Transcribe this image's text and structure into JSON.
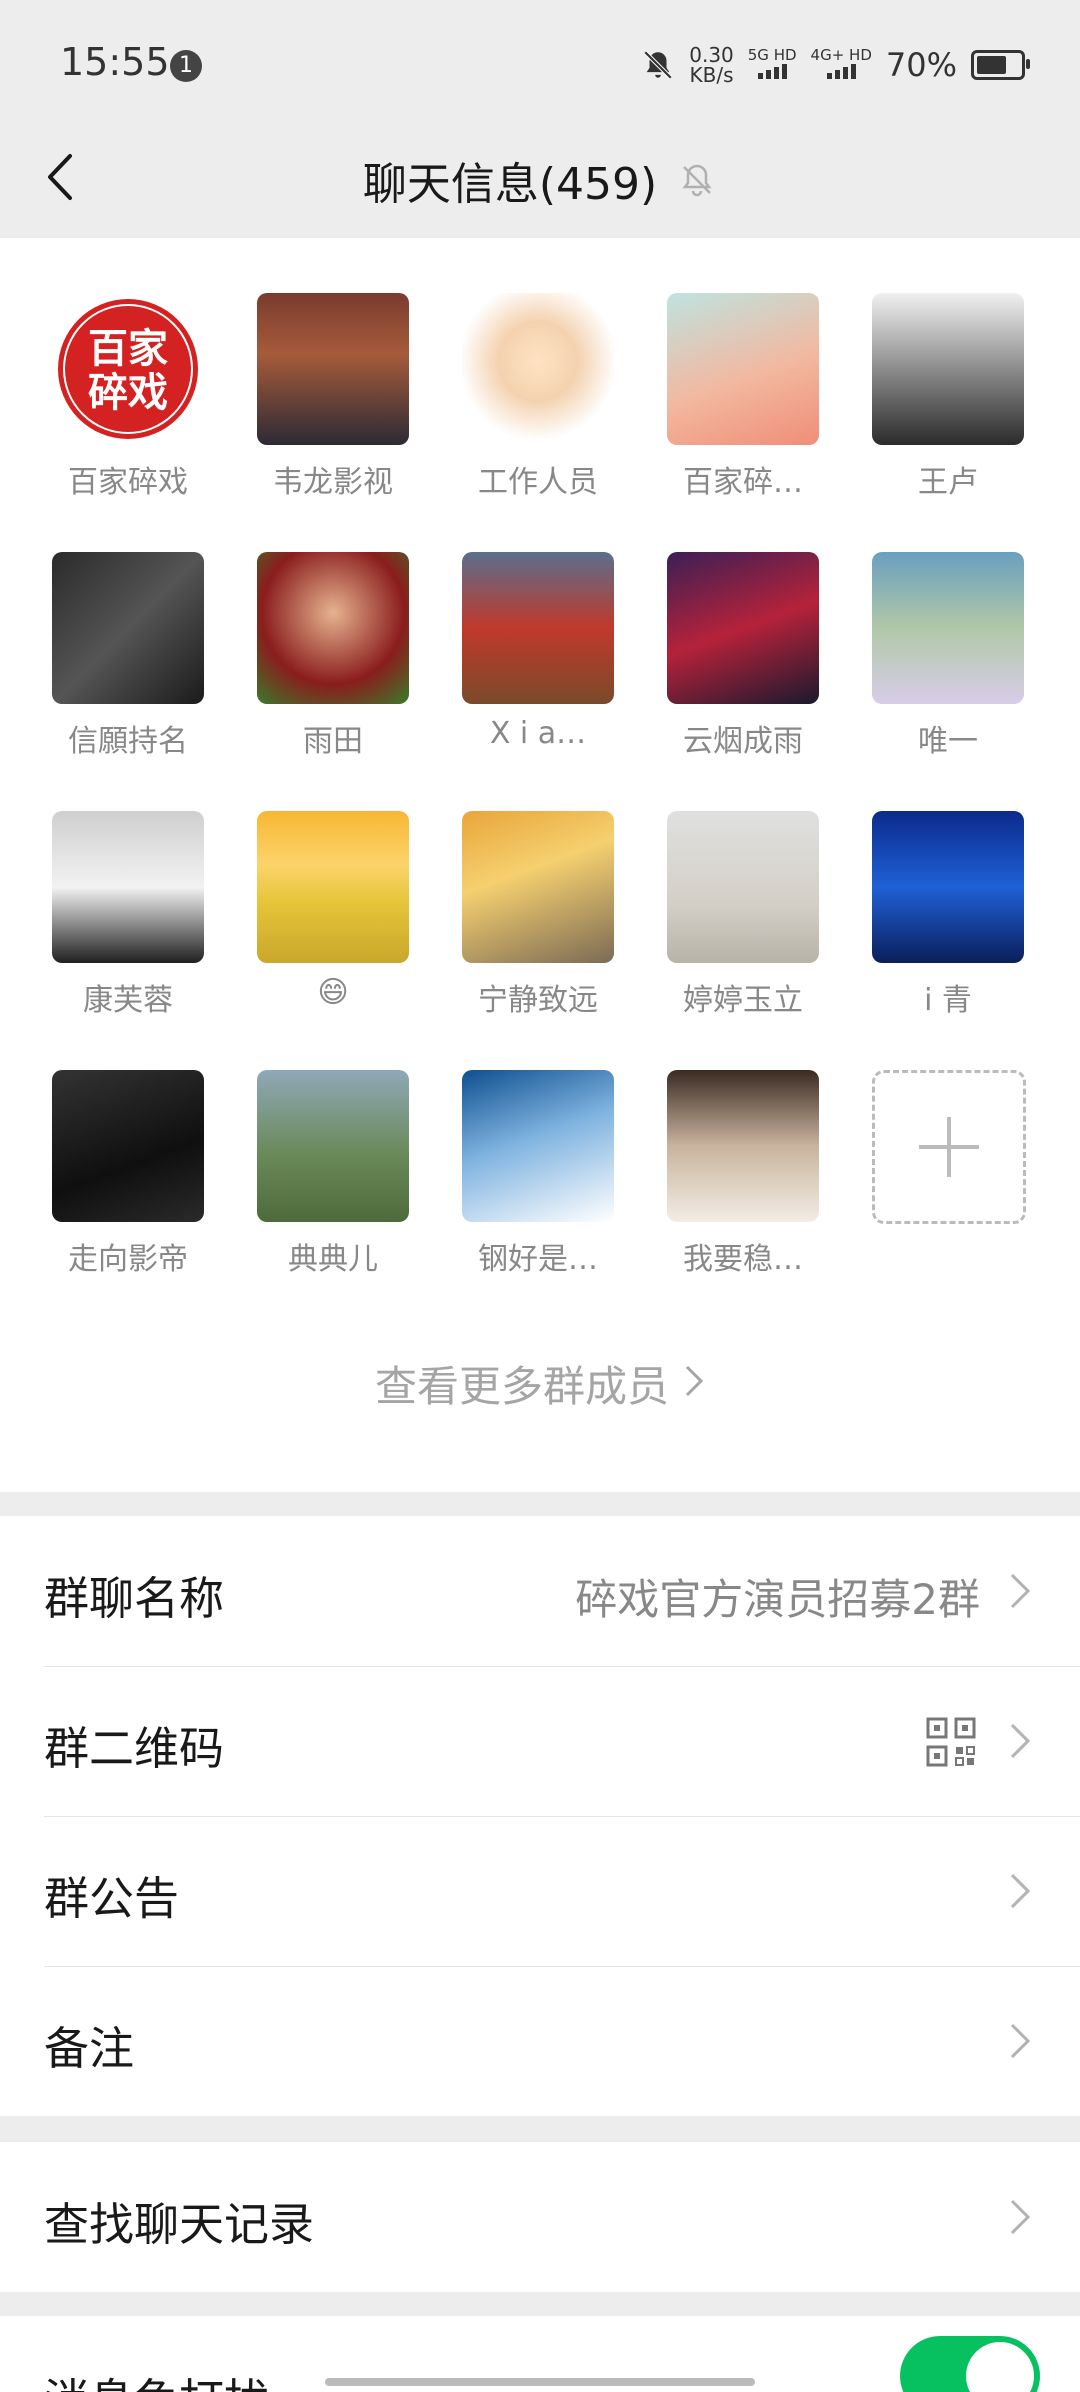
{
  "status_bar": {
    "time": "15:55",
    "notif_count": "1",
    "speed_value": "0.30",
    "speed_unit": "KB/s",
    "net1": "5G HD",
    "net2": "4G+ HD",
    "battery": "70%",
    "battery_level": 0.7
  },
  "header": {
    "title": "聊天信息(459)",
    "back_icon": "back-arrow-icon",
    "mute_icon": "bell-off-icon"
  },
  "members": [
    {
      "name": "百家碎戏"
    },
    {
      "name": "韦龙影视"
    },
    {
      "name": "工作人员"
    },
    {
      "name": "百家碎…"
    },
    {
      "name": "王卢"
    },
    {
      "name": "信願持名"
    },
    {
      "name": "雨田"
    },
    {
      "name": "X i a…"
    },
    {
      "name": "云烟成雨"
    },
    {
      "name": "唯一"
    },
    {
      "name": "康芙蓉"
    },
    {
      "name": "😄"
    },
    {
      "name": "宁静致远"
    },
    {
      "name": "婷婷玉立"
    },
    {
      "name": "i  青"
    },
    {
      "name": "走向影帝"
    },
    {
      "name": "典典儿"
    },
    {
      "name": "钢好是…"
    },
    {
      "name": "我要稳…"
    }
  ],
  "avatar_logo_text": "百家碎戏",
  "add_member_icon": "plus-icon",
  "more_members": "查看更多群成员",
  "settings": {
    "group_name_label": "群聊名称",
    "group_name_value": "碎戏官方演员招募2群",
    "qr_label": "群二维码",
    "notice_label": "群公告",
    "remark_label": "备注",
    "search_label": "查找聊天记录",
    "dnd_label": "消息免打扰",
    "dnd_on": true
  },
  "colors": {
    "accent": "#07c160",
    "background": "#ededed",
    "panel": "#ffffff"
  }
}
